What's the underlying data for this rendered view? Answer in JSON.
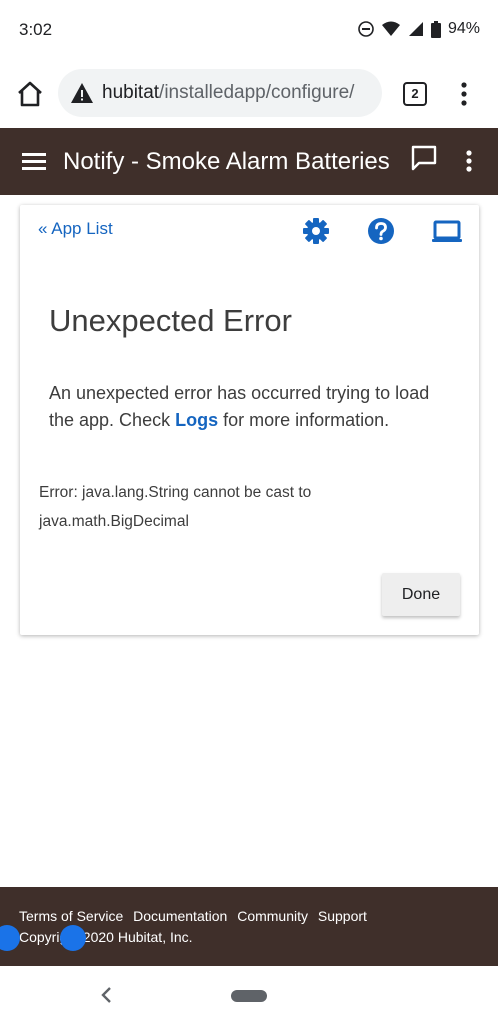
{
  "status_bar": {
    "time": "3:02",
    "battery": "94%"
  },
  "browser": {
    "url_host": "hubitat",
    "url_path": "/installedapp/configure/",
    "tab_count": "2"
  },
  "app_bar": {
    "title": "Notify - Smoke Alarm Batteries"
  },
  "card": {
    "app_list_link": "« App List",
    "error_title": "Unexpected Error",
    "error_msg_before": "An unexpected error has occurred trying to load the app. Check ",
    "logs_link": "Logs",
    "error_msg_after": " for more information.",
    "error_detail": "Error: java.lang.String cannot be cast to java.math.BigDecimal",
    "done_label": "Done"
  },
  "footer": {
    "links": [
      "Terms of Service",
      "Documentation",
      "Community",
      "Support"
    ],
    "copyright": "Copyright 2020 Hubitat, Inc."
  },
  "colors": {
    "app_bar_bg": "#3f2f2a",
    "link": "#1565c0"
  }
}
